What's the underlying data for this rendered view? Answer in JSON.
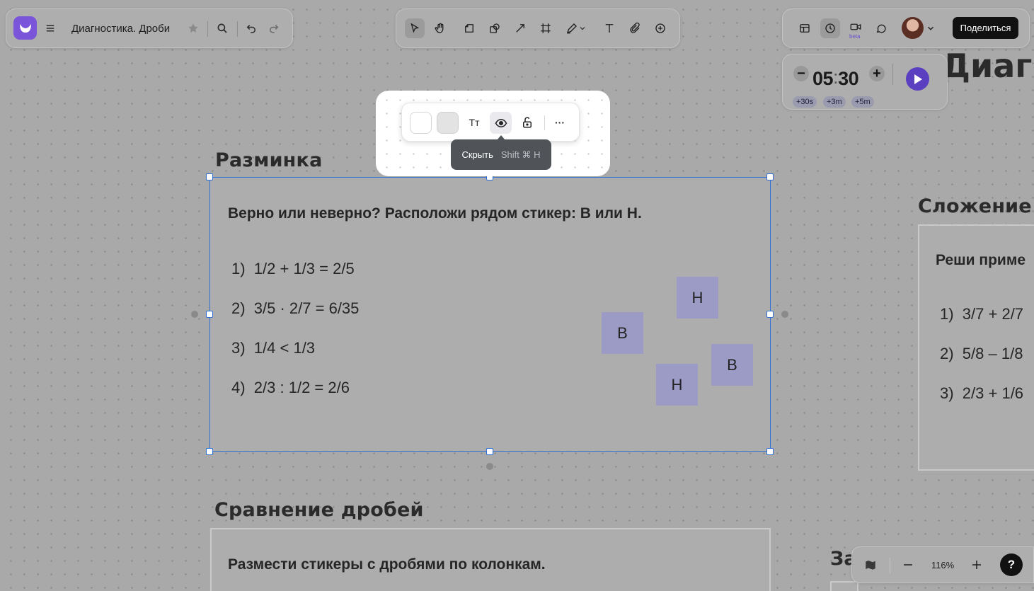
{
  "header": {
    "board_title": "Диагностика. Дроби",
    "share_label": "Поделиться",
    "beta_label": "beta"
  },
  "timer": {
    "minutes": "05",
    "separator": ":",
    "seconds": "30",
    "minus": "−",
    "plus": "+",
    "quick_add": [
      "+30s",
      "+3m",
      "+5m"
    ]
  },
  "context_toolbar": {
    "text_size_label": "Tт",
    "more_label": "···",
    "tooltip_label": "Скрыть",
    "tooltip_shortcut": "Shift ⌘ H"
  },
  "canvas": {
    "partial_heading_top": "Диаг",
    "warmup": {
      "heading": "Разминка",
      "title": "Верно или неверно? Расположи рядом стикер: В или Н.",
      "items": [
        {
          "num": "1)",
          "text": "1/2 + 1/3 = 2/5"
        },
        {
          "num": "2)",
          "text": "3/5 · 2/7 = 6/35"
        },
        {
          "num": "3)",
          "text": "1/4 < 1/3"
        },
        {
          "num": "4)",
          "text": "2/3 : 1/2 = 2/6"
        }
      ],
      "stickers": [
        "Н",
        "В",
        "В",
        "Н"
      ]
    },
    "addition": {
      "heading": "Сложение",
      "title": "Реши приме",
      "items": [
        {
          "num": "1)",
          "text": "3/7 + 2/7"
        },
        {
          "num": "2)",
          "text": "5/8 – 1/8"
        },
        {
          "num": "3)",
          "text": "2/3 + 1/6"
        }
      ]
    },
    "comparison": {
      "heading": "Сравнение дробей",
      "title": "Размести стикеры с дробями по колонкам."
    },
    "partial_heading_bottom": "За"
  },
  "zoom": {
    "level": "116%",
    "help": "?"
  },
  "colors": {
    "accent": "#7a54d9",
    "selection": "#2f6fd6",
    "sticker": "#9c9bc6",
    "play": "#5a3fc0"
  }
}
